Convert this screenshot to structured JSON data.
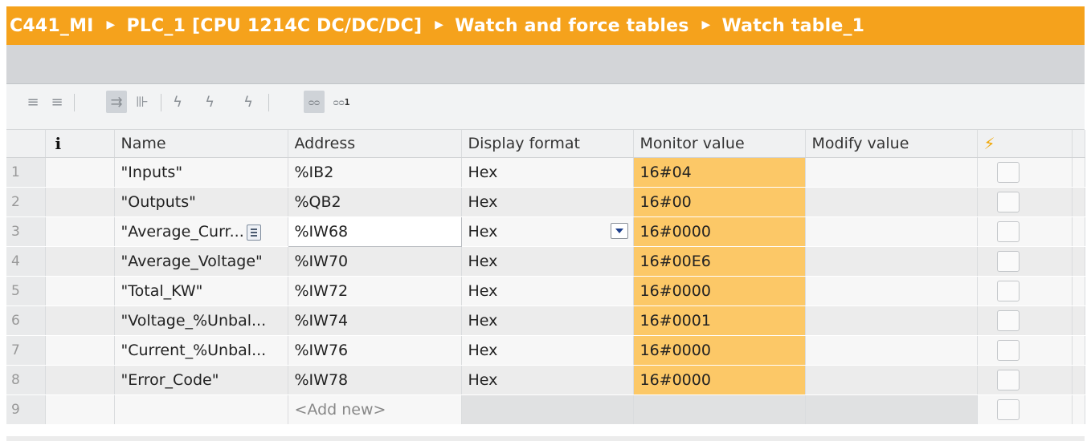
{
  "breadcrumb": {
    "project": "C441_MI",
    "device": "PLC_1 [CPU 1214C DC/DC/DC]",
    "folder": "Watch and force tables",
    "table": "Watch table_1",
    "separator": "▶"
  },
  "toolbar": {
    "icons": [
      "insert-row-icon",
      "add-row-icon",
      "modify-now-icon",
      "modify-trigger-icon",
      "force-icon",
      "force-trigger-icon",
      "stop-force-icon",
      "monitor-all-icon",
      "monitor-once-icon"
    ],
    "monitor_once_sub": "1"
  },
  "columns": {
    "info": "i",
    "name": "Name",
    "address": "Address",
    "display_format": "Display format",
    "monitor_value": "Monitor value",
    "modify_value": "Modify value",
    "modify_flag": "⚡"
  },
  "rows": [
    {
      "num": "1",
      "name": "\"Inputs\"",
      "address": "%IB2",
      "format": "Hex",
      "monitor": "16#04"
    },
    {
      "num": "2",
      "name": "\"Outputs\"",
      "address": "%QB2",
      "format": "Hex",
      "monitor": "16#00"
    },
    {
      "num": "3",
      "name": "\"Average_Curr...",
      "address": "%IW68",
      "format": "Hex",
      "monitor": "16#0000"
    },
    {
      "num": "4",
      "name": "\"Average_Voltage\"",
      "address": "%IW70",
      "format": "Hex",
      "monitor": "16#00E6"
    },
    {
      "num": "5",
      "name": "\"Total_KW\"",
      "address": "%IW72",
      "format": "Hex",
      "monitor": "16#0000"
    },
    {
      "num": "6",
      "name": "\"Voltage_%Unbal...",
      "address": "%IW74",
      "format": "Hex",
      "monitor": "16#0001"
    },
    {
      "num": "7",
      "name": "\"Current_%Unbal...",
      "address": "%IW76",
      "format": "Hex",
      "monitor": "16#0000"
    },
    {
      "num": "8",
      "name": "\"Error_Code\"",
      "address": "%IW78",
      "format": "Hex",
      "monitor": "16#0000"
    }
  ],
  "add_row": {
    "num": "9",
    "placeholder": "<Add new>"
  },
  "colors": {
    "accent": "#f5a21c",
    "monitor_highlight": "#fcc867"
  }
}
